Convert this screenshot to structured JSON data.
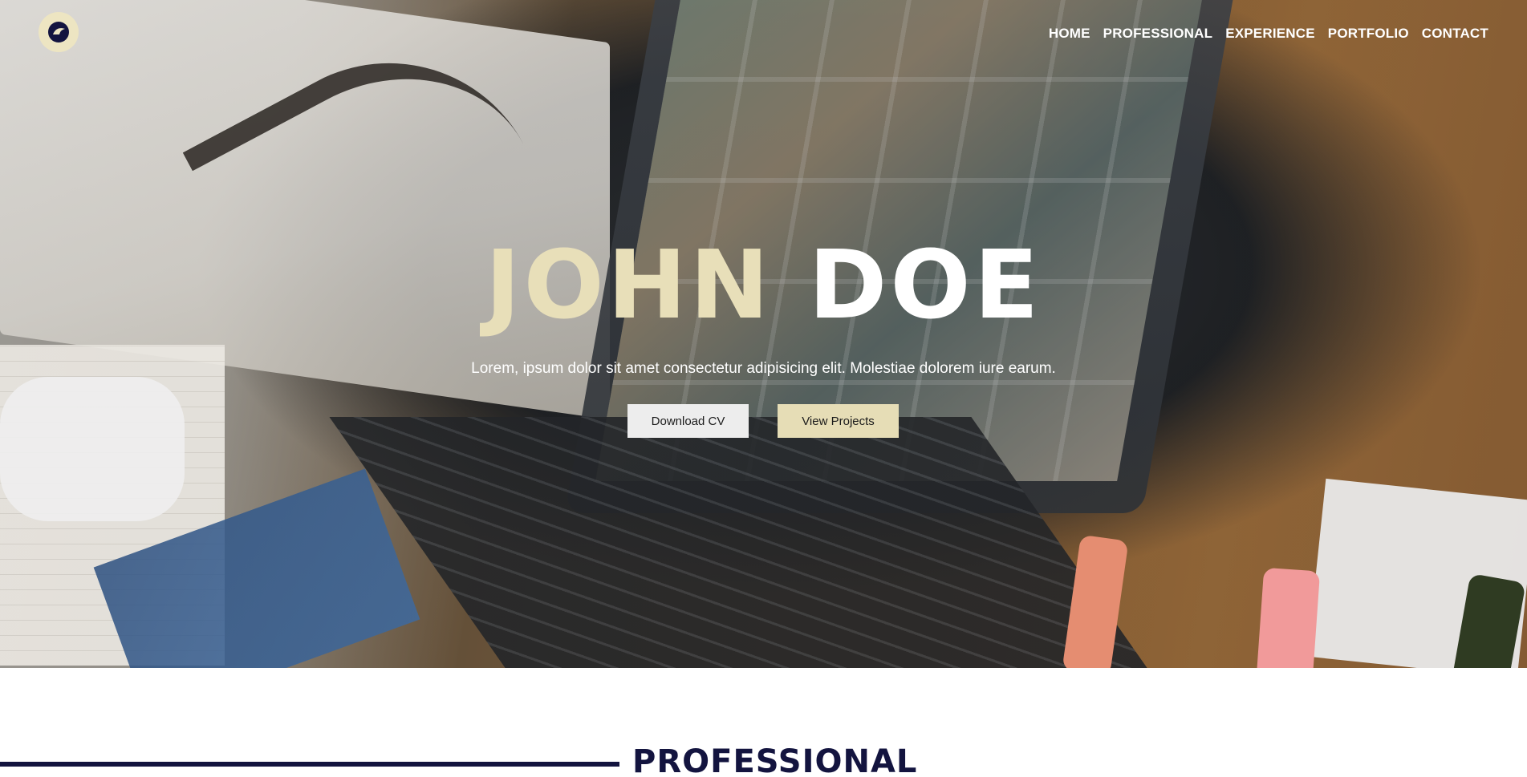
{
  "logo": {
    "icon": "eagle-emblem-icon",
    "background": "#ede5c2"
  },
  "nav": {
    "items": [
      {
        "label": "HOME"
      },
      {
        "label": "PROFESSIONAL"
      },
      {
        "label": "EXPERIENCE"
      },
      {
        "label": "PORTFOLIO"
      },
      {
        "label": "CONTACT"
      }
    ]
  },
  "hero": {
    "first_name": "JOHN",
    "last_name": "DOE",
    "subtitle": "Lorem, ipsum dolor sit amet consectetur adipisicing elit. Molestiae dolorem iure earum.",
    "buttons": {
      "download_cv": "Download CV",
      "view_projects": "View Projects"
    },
    "colors": {
      "accent": "#e8dfb9",
      "button_light": "#ededed",
      "button_accent": "#e6ddb6"
    }
  },
  "section": {
    "title": "PROFESSIONAL",
    "color": "#13143f"
  }
}
